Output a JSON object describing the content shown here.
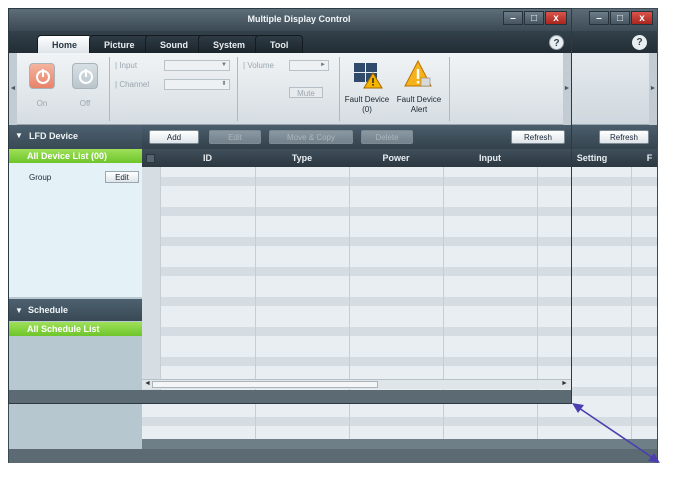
{
  "app": {
    "title": "Multiple Display Control",
    "window_controls": [
      "–",
      "□",
      "x"
    ],
    "help_label": "?"
  },
  "tabs": [
    {
      "label": "Home",
      "active": true
    },
    {
      "label": "Picture",
      "active": false
    },
    {
      "label": "Sound",
      "active": false
    },
    {
      "label": "System",
      "active": false
    },
    {
      "label": "Tool",
      "active": false
    }
  ],
  "ribbon": {
    "power_on_label": "On",
    "power_off_label": "Off",
    "input_label": "Input",
    "channel_label": "Channel",
    "volume_label": "Volume",
    "mute_label": "Mute",
    "fault_device_label": "Fault Device",
    "fault_device_count": "(0)",
    "fault_alert_label_1": "Fault Device",
    "fault_alert_label_2": "Alert"
  },
  "toolbar": {
    "add_label": "Add",
    "edit_label": "Edit",
    "move_copy_label": "Move & Copy",
    "delete_label": "Delete",
    "refresh_label": "Refresh"
  },
  "left_panel": {
    "lfd_header": "LFD Device",
    "all_device_list": "All Device List (00)",
    "group_label": "Group",
    "group_edit_label": "Edit",
    "schedule_header": "Schedule",
    "all_schedule_list": "All Schedule List"
  },
  "grid": {
    "columns": [
      "ID",
      "Type",
      "Power",
      "Input"
    ]
  },
  "back_window": {
    "refresh_label": "Refresh",
    "setting_col": "Setting",
    "extra_col": "F",
    "window_controls": [
      "–",
      "□",
      "x"
    ],
    "help_label": "?"
  },
  "colors": {
    "accent_green": "#6ec52a",
    "header_dark": "#394955",
    "fault_red": "#d9371b",
    "fault_yellow": "#f5b400",
    "arrow_color": "#4b3fb0"
  }
}
